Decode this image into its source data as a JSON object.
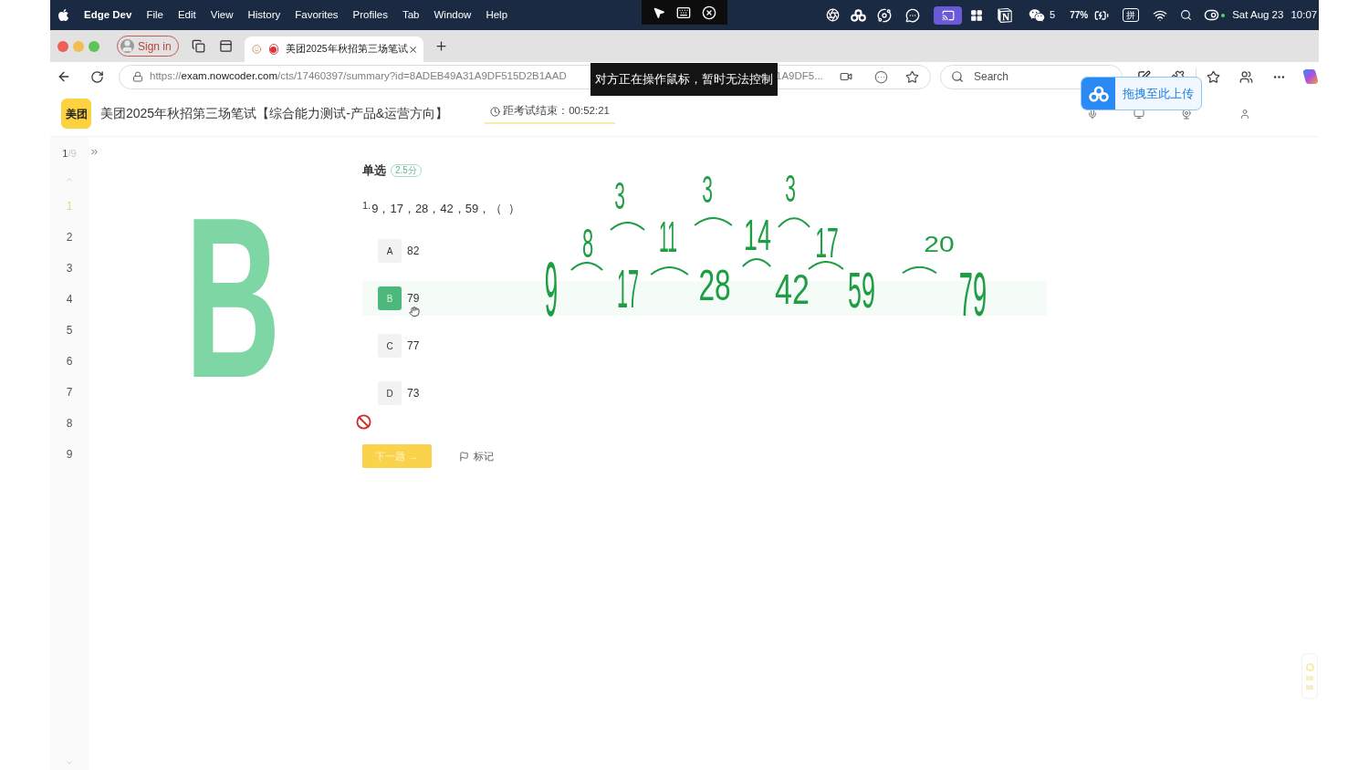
{
  "menu_bar": {
    "app_name": "Edge Dev",
    "menus": [
      "File",
      "Edit",
      "View",
      "History",
      "Favorites",
      "Profiles",
      "Tab",
      "Window",
      "Help"
    ],
    "screen_mirroring": {
      "on": true
    },
    "wechat_count": "5",
    "battery": "77%",
    "input_method": "拼",
    "date": "Sat Aug 23",
    "time": "10:07"
  },
  "tab_bar": {
    "sign_in": "Sign in",
    "tabs": [
      {
        "title": "美团2025年秋招第三场笔试",
        "selected": true
      }
    ]
  },
  "address_bar": {
    "url_scheme": "https://",
    "url_host": "exam.nowcoder.com",
    "url_path": "/cts/17460397/summary?id=8ADEB49A31A9DF515D2B1AAD",
    "url_tail": "1A9DF5...",
    "search_placeholder": "Search"
  },
  "remote_tooltip": "对方正在操作鼠标，暂时无法控制",
  "upload_popup": {
    "label": "拖拽至此上传"
  },
  "exam_header": {
    "logo": "美团",
    "title": "美团2025年秋招第三场笔试【综合能力测试-产品&运营方向】",
    "timer": "距考试结束：00:52:21"
  },
  "question_nav": {
    "current": "1",
    "total": "/9",
    "items": [
      {
        "label": "1",
        "selected": true
      },
      {
        "label": "2",
        "selected": false
      },
      {
        "label": "3",
        "selected": false
      },
      {
        "label": "4",
        "selected": false
      },
      {
        "label": "5",
        "selected": false
      },
      {
        "label": "6",
        "selected": false
      },
      {
        "label": "7",
        "selected": false
      },
      {
        "label": "8",
        "selected": false
      },
      {
        "label": "9",
        "selected": false
      }
    ]
  },
  "question": {
    "type": "单选",
    "score": "2.5分",
    "number": "1.",
    "stem": "9，17，28，42，59，（  ）",
    "options": [
      {
        "letter": "A",
        "text": "82",
        "selected": false
      },
      {
        "letter": "B",
        "text": "79",
        "selected": true
      },
      {
        "letter": "C",
        "text": "77",
        "selected": false
      },
      {
        "letter": "D",
        "text": "73",
        "selected": false
      }
    ],
    "next_button": "下一题 →",
    "mark_button": "标记"
  },
  "annotations": {
    "big_letter": "B",
    "numbers": [
      "3",
      "3",
      "3",
      "8",
      "11",
      "14",
      "17",
      "20",
      "9",
      "17",
      "28",
      "42",
      "59",
      "79"
    ]
  }
}
